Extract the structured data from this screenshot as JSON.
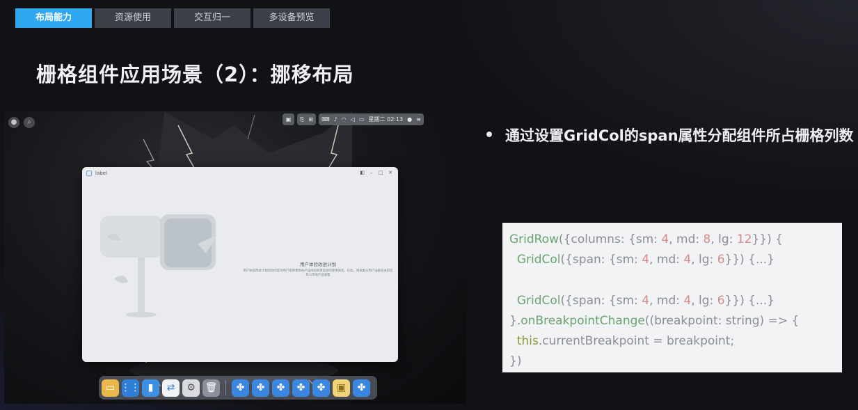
{
  "tabs": [
    {
      "label": "布局能力",
      "active": true
    },
    {
      "label": "资源使用",
      "active": false
    },
    {
      "label": "交互归一",
      "active": false
    },
    {
      "label": "多设备预览",
      "active": false
    }
  ],
  "slide": {
    "title": "栅格组件应用场景（2）：挪移布局",
    "bullet": "通过设置GridCol的span属性分配组件所占栅格列数"
  },
  "screen": {
    "statusbar": {
      "date_time": "星期二 02:13"
    },
    "window": {
      "title": "label",
      "heading": "用户体验改进计划",
      "description": "用户体验改进计划的目的是为用户提供更新的产品体验和更高效的使用体验。在此，将采集与用户设备有关的信息以改进产品质量"
    },
    "dock_icons": [
      "folder-icon",
      "app-grid-icon",
      "notes-icon",
      "files-icon",
      "settings-icon",
      "trash-icon",
      "app-icon",
      "app-icon",
      "app-icon",
      "app-icon",
      "app-icon",
      "gallery-icon",
      "app-icon"
    ]
  },
  "code": {
    "line1_fn": "GridRow",
    "line1_a": "({columns: {sm: ",
    "line1_n1": "4",
    "line1_b": ", md: ",
    "line1_n2": "8",
    "line1_c": ", lg: ",
    "line1_n3": "12",
    "line1_d": "}}) {",
    "line2_fn": "GridCol",
    "line2_a": "({span: {sm: ",
    "line2_n1": "4",
    "line2_b": ", md: ",
    "line2_n2": "4",
    "line2_c": ", lg: ",
    "line2_n3": "6",
    "line2_d": "}}) {...}",
    "line4_fn": "GridCol",
    "line4_a": "({span: {sm: ",
    "line4_n1": "4",
    "line4_b": ", md: ",
    "line4_n2": "4",
    "line4_c": ", lg: ",
    "line4_n3": "6",
    "line4_d": "}}) {...}",
    "line5_a": "}.",
    "line5_fn": "onBreakpointChange",
    "line5_b": "((breakpoint: string) => {",
    "line6_kw": "this",
    "line6_a": ".currentBreakpoint = breakpoint;",
    "line7": "})"
  },
  "colors": {
    "active_tab": "#2ea8f0",
    "inactive_tab": "#3c3f48",
    "code_bg": "#f2f3f4",
    "code_fn": "#6aa46e",
    "code_num": "#d88a8a",
    "code_kw": "#8a9a33"
  }
}
